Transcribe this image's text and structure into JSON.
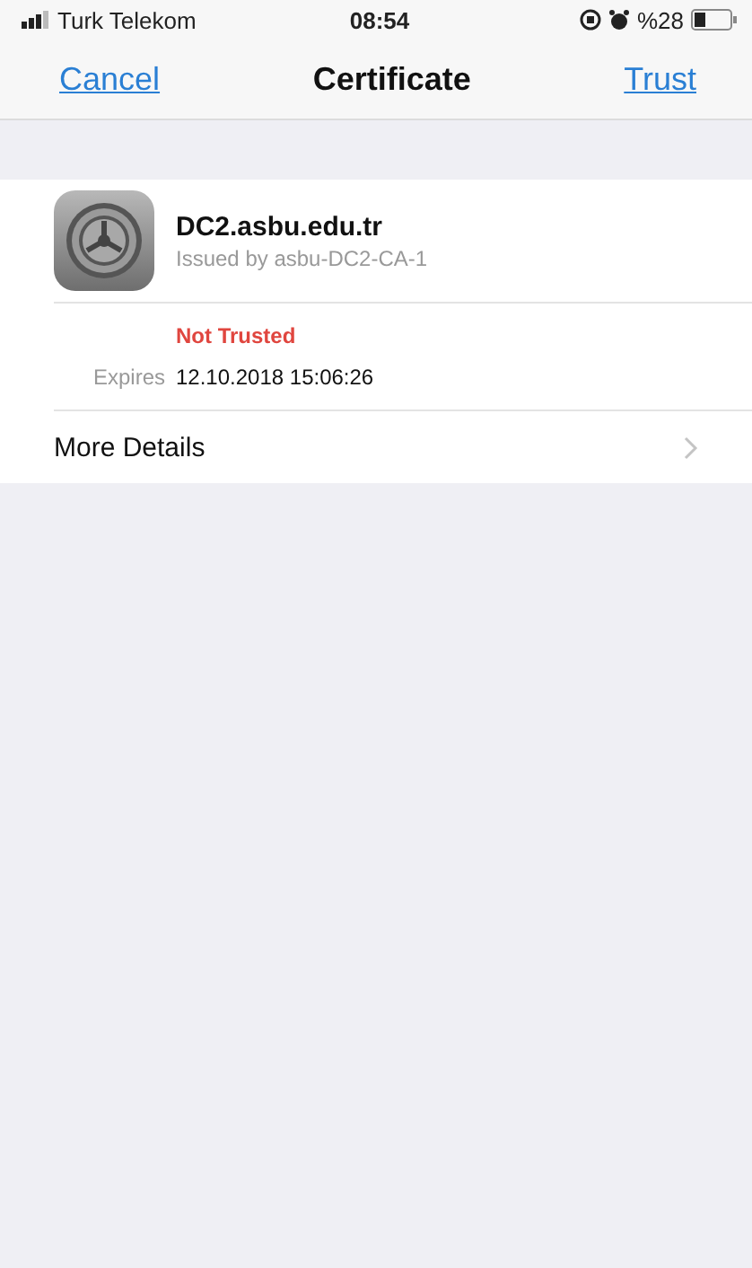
{
  "status_bar": {
    "carrier": "Turk Telekom",
    "time": "08:54",
    "battery": "%28"
  },
  "nav": {
    "cancel": "Cancel",
    "title": "Certificate",
    "trust": "Trust"
  },
  "certificate": {
    "name": "DC2.asbu.edu.tr",
    "issuer": "Issued by asbu-DC2-CA-1",
    "status": "Not Trusted",
    "trusted": false,
    "expires_label": "Expires",
    "expires": "12.10.2018 15:06:26"
  },
  "more_details": "More Details"
}
